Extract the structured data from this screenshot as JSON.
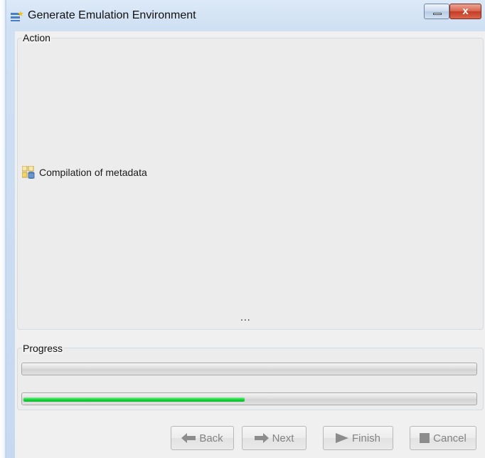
{
  "window": {
    "title": "Generate Emulation Environment",
    "close_glyph": "x"
  },
  "action": {
    "label": "Action",
    "task": {
      "icon": "metadata-compile-icon",
      "text": "Compilation of metadata"
    },
    "ellipsis": "..."
  },
  "progress": {
    "label": "Progress",
    "bars": [
      {
        "value": 0.0
      },
      {
        "value": 0.49,
        "color": "#17d33b"
      }
    ]
  },
  "buttons": {
    "back": {
      "label": "Back",
      "icon": "arrow-left-icon"
    },
    "next": {
      "label": "Next",
      "icon": "arrow-right-icon"
    },
    "finish": {
      "label": "Finish",
      "icon": "play-icon"
    },
    "cancel": {
      "label": "Cancel",
      "icon": "stop-icon"
    }
  },
  "colors": {
    "titlebar": "#dce9f7",
    "close_button": "#c33c25",
    "progress_fill": "#17d33b",
    "disabled_text": "#838383"
  }
}
